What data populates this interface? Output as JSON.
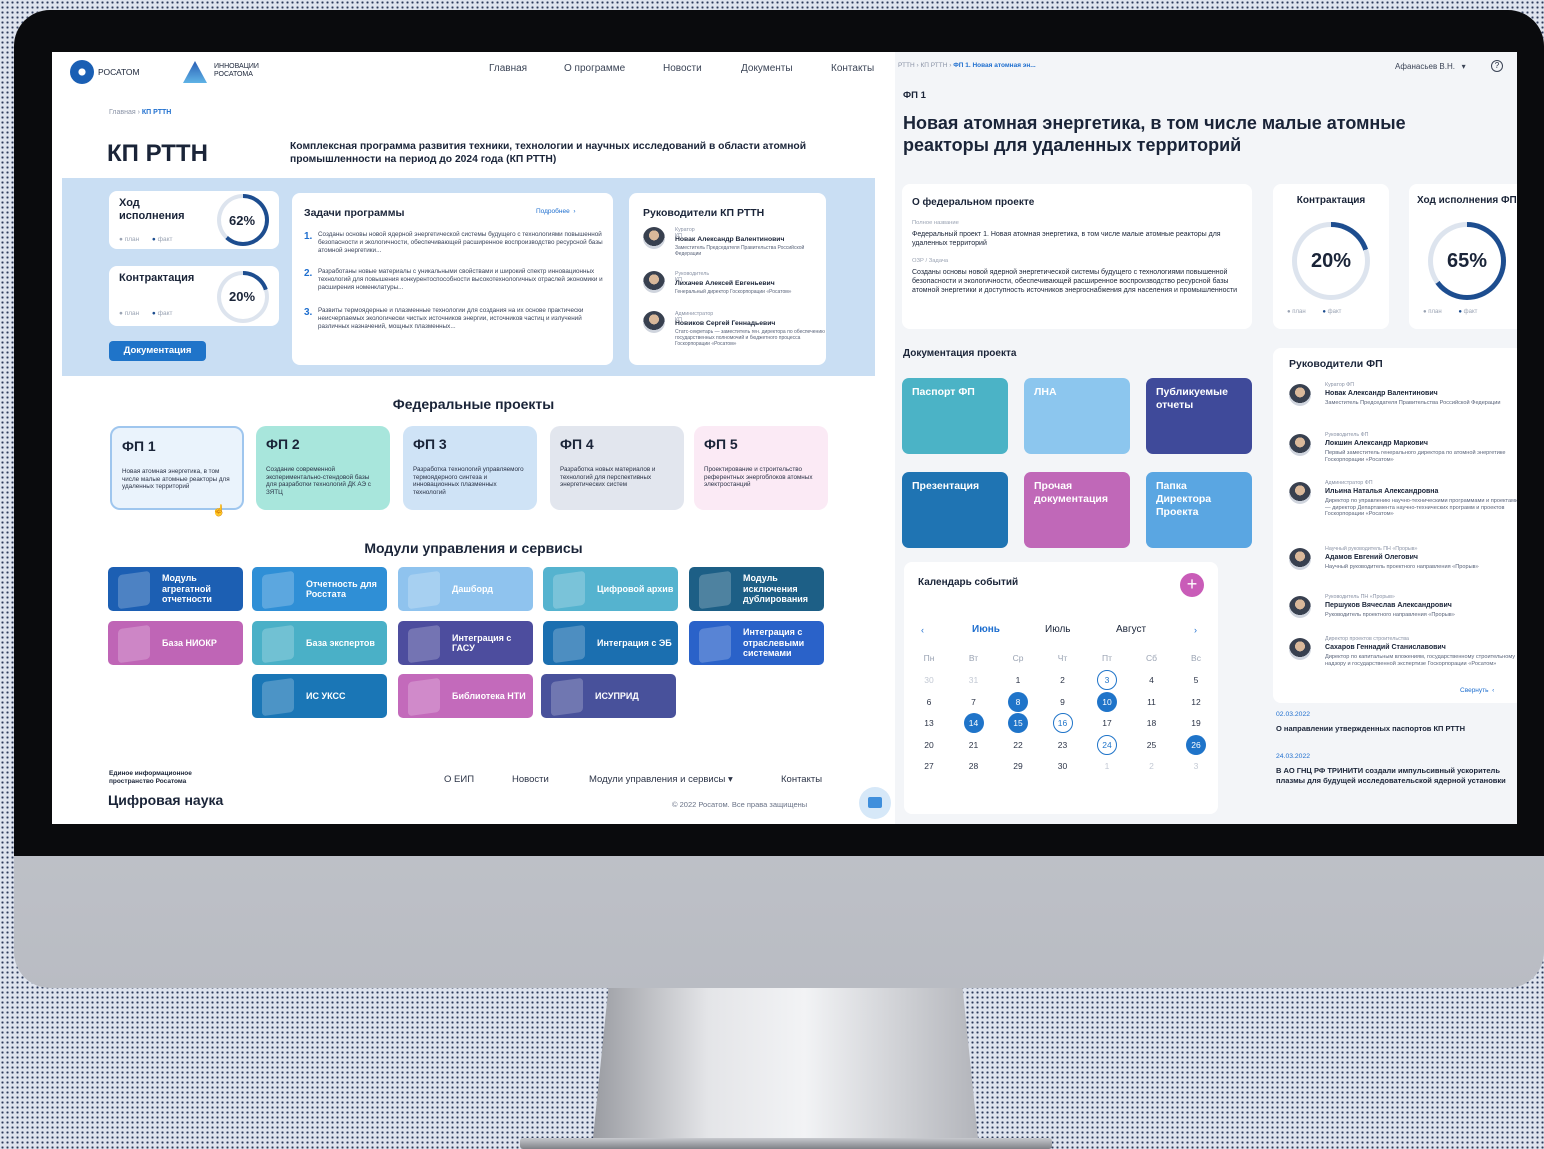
{
  "header": {
    "logo1": "РОСАТОМ",
    "logo2_line1": "ИННОВАЦИИ",
    "logo2_line2": "РОСАТОМА",
    "nav": [
      "Главная",
      "О программе",
      "Новости",
      "Документы",
      "Контакты"
    ]
  },
  "breadcrumb": {
    "home": "Главная",
    "current": "КП РТТН"
  },
  "page": {
    "title": "КП РТТН",
    "subtitle": "Комплексная программа развития техники, технологии и научных исследований в области атомной промышленности на период до 2024 года (КП РТТН)"
  },
  "progress": {
    "label": "Ход исполнения",
    "value": "62%",
    "fraction": 0.62,
    "plan": "план",
    "fact": "факт"
  },
  "contracting": {
    "label": "Контрактация",
    "value": "20%",
    "fraction": 0.2,
    "plan": "план",
    "fact": "факт"
  },
  "documentation_button": "Документация",
  "tasks": {
    "title": "Задачи программы",
    "more": "Подробнее",
    "items": [
      {
        "n": "1.",
        "text": "Созданы основы новой ядерной энергетической системы будущего с технологиями повышенной безопасности и экологичности, обеспечивающей расширенное воспроизводство ресурсной базы атомной энергетики..."
      },
      {
        "n": "2.",
        "text": "Разработаны новые материалы с уникальными свойствами и широкий спектр инновационных технологий для повышения конкурентоспособности высокотехнологичных отраслей экономики и расширения номенклатуры..."
      },
      {
        "n": "3.",
        "text": "Развиты термоядерные и плазменные технологии для создания на их основе практически неисчерпаемых экологически чистых источников энергии, источников частиц и излучений различных назначений, мощных плазменных..."
      }
    ]
  },
  "leaders_kp": {
    "title": "Руководители КП РТТН",
    "items": [
      {
        "role": "Куратор КП",
        "name": "Новак Александр Валентинович",
        "desc": "Заместитель Председателя Правительства Российской Федерации"
      },
      {
        "role": "Руководитель КП",
        "name": "Лихачев Алексей Евгеньевич",
        "desc": "Генеральный директор Госкорпорации «Росатом»"
      },
      {
        "role": "Администратор КП",
        "name": "Новиков Сергей Геннадьевич",
        "desc": "Статс-секретарь — заместитель ген. директора по обеспечению государственных полномочий и бюджетного процесса Госкорпорации «Росатом»"
      }
    ]
  },
  "federal": {
    "title": "Федеральные проекты",
    "items": [
      {
        "code": "ФП 1",
        "text": "Новая атомная энергетика, в том числе малые атомные реакторы для удаленных территорий",
        "color": "#eaf3fc"
      },
      {
        "code": "ФП 2",
        "text": "Создание современной экспериментально-стендовой базы для разработки технологий ДК АЭ с ЗЯТЦ",
        "color": "#a8e6dc"
      },
      {
        "code": "ФП 3",
        "text": "Разработка технологий управляемого термоядерного синтеза и инновационных плазменных технологий",
        "color": "#cfe3f6"
      },
      {
        "code": "ФП 4",
        "text": "Разработка новых материалов и технологий для перспективных энергетических систем",
        "color": "#e2e6ee"
      },
      {
        "code": "ФП 5",
        "text": "Проектирование и строительство референтных энергоблоков атомных электростанций",
        "color": "#fbeaf5"
      }
    ]
  },
  "modules": {
    "title": "Модули управления и сервисы",
    "items": [
      {
        "label": "Модуль агрегатной отчетности",
        "color": "#1c5fb3"
      },
      {
        "label": "Отчетность для Росстата",
        "color": "#2f8fd6"
      },
      {
        "label": "Дашборд",
        "color": "#8fc3ee"
      },
      {
        "label": "Цифровой архив",
        "color": "#55b3cf"
      },
      {
        "label": "Модуль исключения дублирования",
        "color": "#1d5f86"
      },
      {
        "label": "База НИОКР",
        "color": "#bf65b6"
      },
      {
        "label": "База экспертов",
        "color": "#4ab0c7"
      },
      {
        "label": "Интеграция с ГАСУ",
        "color": "#4d4d9e"
      },
      {
        "label": "Интеграция с ЭБ",
        "color": "#1b6fb0"
      },
      {
        "label": "Интеграция с отраслевыми системами",
        "color": "#2a62c9"
      },
      {
        "label": "ИС УКСС",
        "color": "#1a76b6"
      },
      {
        "label": "Библиотека НТИ",
        "color": "#c36abb"
      },
      {
        "label": "ИСУПРИД",
        "color": "#48519b"
      }
    ]
  },
  "footer": {
    "tagline1": "Единое информационное",
    "tagline2": "пространство Росатома",
    "brand": "Цифровая наука",
    "links": [
      "О ЕИП",
      "Новости",
      "Модули управления и сервисы ▾",
      "Контакты"
    ],
    "copyright": "© 2022 Росатом. Все права защищены"
  },
  "right": {
    "breadcrumb": [
      "РТТН",
      "КП РТТН",
      "ФП 1. Новая атомная эн..."
    ],
    "user": "Афанасьев В.Н.",
    "fp_code": "ФП 1",
    "title_line1": "Новая атомная энергетика, в том числе малые атомные",
    "title_line2": "реакторы для удаленных территорий",
    "about": {
      "title": "О федеральном проекте",
      "full_name_label": "Полное название",
      "full_name": "Федеральный проект 1. Новая атомная энергетика, в том числе малые атомные реакторы для удаленных территорий",
      "task_label": "ОЗР / Задача",
      "task": "Созданы основы новой ядерной энергетической системы будущего с технологиями повышенной безопасности и экологичности, обеспечивающей расширенное воспроизводство ресурсной базы атомной энергетики и доступность источников энергоснабжения для населения и промышленности"
    },
    "contracting": {
      "label": "Контрактация",
      "value": "20%",
      "fraction": 0.2,
      "plan": "план",
      "fact": "факт"
    },
    "progress": {
      "label": "Ход исполнения ФП",
      "value": "65%",
      "fraction": 0.65,
      "plan": "план",
      "fact": "факт"
    },
    "docs_title": "Документация проекта",
    "docs": [
      {
        "label": "Паспорт ФП",
        "color": "#4bb3c6"
      },
      {
        "label": "ЛНА",
        "color": "#8cc6ee"
      },
      {
        "label": "Публикуемые отчеты",
        "color": "#3f4a9a"
      },
      {
        "label": "Презентация",
        "color": "#1f74b3"
      },
      {
        "label": "Прочая документация",
        "color": "#c068b8"
      },
      {
        "label": "Папка Директора Проекта",
        "color": "#5aa6e2"
      }
    ],
    "calendar": {
      "title": "Календарь событий",
      "months": [
        "Июнь",
        "Июль",
        "Август"
      ],
      "weekdays": [
        "Пн",
        "Вт",
        "Ср",
        "Чт",
        "Пт",
        "Сб",
        "Вс"
      ],
      "weeks": [
        [
          "30",
          "31",
          "1",
          "2",
          "3",
          "4",
          "5"
        ],
        [
          "6",
          "7",
          "8",
          "9",
          "10",
          "11",
          "12"
        ],
        [
          "13",
          "14",
          "15",
          "16",
          "17",
          "18",
          "19"
        ],
        [
          "20",
          "21",
          "22",
          "23",
          "24",
          "25",
          "26"
        ],
        [
          "27",
          "28",
          "29",
          "30",
          "1",
          "2",
          "3"
        ]
      ]
    },
    "leaders": {
      "title": "Руководители ФП",
      "collapse": "Свернуть",
      "items": [
        {
          "role": "Куратор ФП",
          "name": "Новак Александр Валентинович",
          "desc": "Заместитель Председателя Правительства Российской Федерации"
        },
        {
          "role": "Руководитель ФП",
          "name": "Локшин Александр Маркович",
          "desc": "Первый заместитель генерального директора по атомной энергетике Госкорпорации «Росатом»"
        },
        {
          "role": "Администратор ФП",
          "name": "Ильина Наталья Александровна",
          "desc": "Директор по управлению научно-техническими программами и проектами — директор Департамента научно-технических программ и проектов Госкорпорации «Росатом»"
        },
        {
          "role": "Научный руководитель ПН «Прорыв»",
          "name": "Адамов Евгений Олегович",
          "desc": "Научный руководитель проектного направления «Прорыв»"
        },
        {
          "role": "Руководитель ПН «Прорыв»",
          "name": "Першуков Вячеслав Александрович",
          "desc": "Руководитель проектного направления «Прорыв»"
        },
        {
          "role": "Директор проектов строительства",
          "name": "Сахаров Геннадий Станиславович",
          "desc": "Директор по капитальным вложениям, государственному строительному надзору и государственной экспертизе Госкорпорации «Росатом»"
        }
      ]
    },
    "news": [
      {
        "date": "02.03.2022",
        "text": "О направлении утвержденных паспортов КП РТТН"
      },
      {
        "date": "24.03.2022",
        "text": "В АО ГНЦ РФ ТРИНИТИ создали импульсивный ускоритель плазмы для будущей исследовательской ядерной установки"
      }
    ]
  }
}
